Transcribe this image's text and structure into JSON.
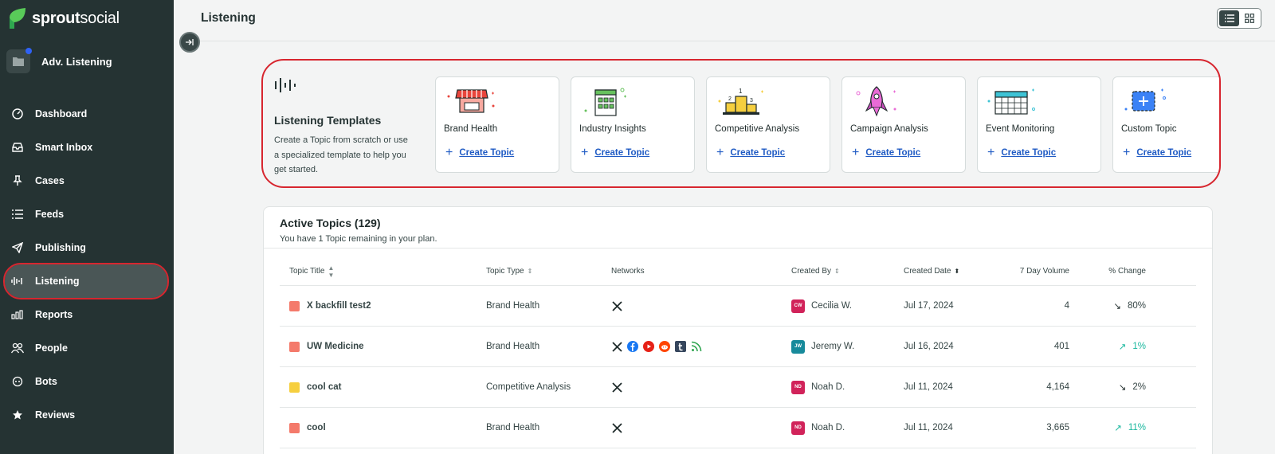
{
  "app": {
    "brand_bold": "sprout",
    "brand_light": "social",
    "workspace": "Adv. Listening"
  },
  "sidebar": {
    "items": [
      {
        "label": "Dashboard",
        "icon": "dashboard-icon"
      },
      {
        "label": "Smart Inbox",
        "icon": "inbox-icon"
      },
      {
        "label": "Cases",
        "icon": "pin-icon"
      },
      {
        "label": "Feeds",
        "icon": "list-icon"
      },
      {
        "label": "Publishing",
        "icon": "paper-plane-icon"
      },
      {
        "label": "Listening",
        "icon": "waveform-icon",
        "active": true
      },
      {
        "label": "Reports",
        "icon": "bar-chart-icon"
      },
      {
        "label": "People",
        "icon": "people-icon"
      },
      {
        "label": "Bots",
        "icon": "bot-icon"
      },
      {
        "label": "Reviews",
        "icon": "star-icon"
      }
    ]
  },
  "header": {
    "title": "Listening"
  },
  "templates": {
    "title": "Listening Templates",
    "description": "Create a Topic from scratch or use a specialized template to help you get started.",
    "create_label": "Create Topic",
    "cards": [
      {
        "title": "Brand Health",
        "icon": "storefront-illustration"
      },
      {
        "title": "Industry Insights",
        "icon": "building-illustration"
      },
      {
        "title": "Competitive Analysis",
        "icon": "podium-illustration"
      },
      {
        "title": "Campaign Analysis",
        "icon": "rocket-illustration"
      },
      {
        "title": "Event Monitoring",
        "icon": "calendar-illustration"
      },
      {
        "title": "Custom Topic",
        "icon": "custom-add-illustration"
      }
    ]
  },
  "topics": {
    "title": "Active Topics",
    "count": "(129)",
    "subtitle": "You have 1 Topic remaining in your plan.",
    "columns": [
      "Topic Title",
      "Topic Type",
      "Networks",
      "Created By",
      "Created Date",
      "7 Day Volume",
      "% Change"
    ],
    "rows": [
      {
        "title": "X backfill test2",
        "color": "#f47a6b",
        "type": "Brand Health",
        "networks": [
          "x"
        ],
        "initials": "CW",
        "avatar_color": "#d1235a",
        "creator": "Cecilia W.",
        "date": "Jul 17, 2024",
        "volume": "4",
        "change": "80%",
        "direction": "down"
      },
      {
        "title": "UW Medicine",
        "color": "#f47a6b",
        "type": "Brand Health",
        "networks": [
          "x",
          "facebook",
          "youtube",
          "reddit",
          "tumblr",
          "rss"
        ],
        "initials": "JW",
        "avatar_color": "#178a9b",
        "creator": "Jeremy W.",
        "date": "Jul 16, 2024",
        "volume": "401",
        "change": "1%",
        "direction": "up"
      },
      {
        "title": "cool cat",
        "color": "#f6cf3f",
        "type": "Competitive Analysis",
        "networks": [
          "x"
        ],
        "initials": "ND",
        "avatar_color": "#d1235a",
        "creator": "Noah D.",
        "date": "Jul 11, 2024",
        "volume": "4,164",
        "change": "2%",
        "direction": "down"
      },
      {
        "title": "cool",
        "color": "#f47a6b",
        "type": "Brand Health",
        "networks": [
          "x"
        ],
        "initials": "ND",
        "avatar_color": "#d1235a",
        "creator": "Noah D.",
        "date": "Jul 11, 2024",
        "volume": "3,665",
        "change": "11%",
        "direction": "up"
      }
    ]
  },
  "colors": {
    "sidebar": "#253333",
    "accent_link": "#205bc4",
    "highlight": "#d7262f",
    "up": "#1bb89f",
    "down": "#364646"
  }
}
